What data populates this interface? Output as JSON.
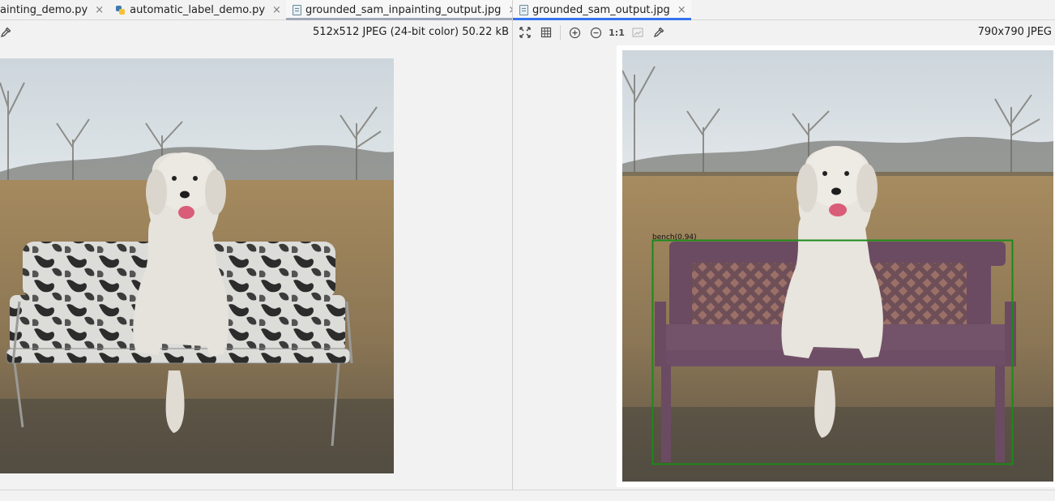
{
  "left_tabs": [
    {
      "label": "ainting_demo.py",
      "type": "python"
    },
    {
      "label": "automatic_label_demo.py",
      "type": "python"
    },
    {
      "label": "grounded_sam_inpainting_output.jpg",
      "type": "image",
      "active": true
    }
  ],
  "right_tabs": [
    {
      "label": "grounded_sam_output.jpg",
      "type": "image",
      "active": true
    }
  ],
  "left_viewer": {
    "info": "512x512 JPEG (24-bit color) 50.22 kB"
  },
  "right_viewer": {
    "info": "790x790 JPEG",
    "actual_size_label": "1:1"
  },
  "detection": {
    "label": "bench(0.94)",
    "box_color": "#1a8a1a"
  },
  "icons": {
    "close": "×",
    "chevron": "⌄",
    "more": "⋮"
  },
  "colors": {
    "accent": "#3574f0",
    "background": "#f2f2f2"
  }
}
